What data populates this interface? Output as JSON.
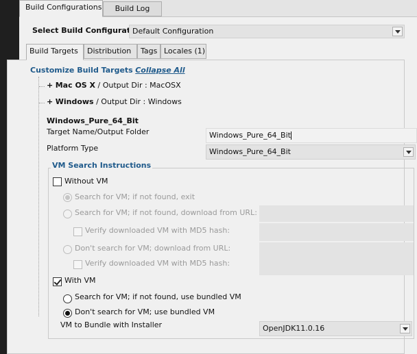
{
  "tabs": [
    "Build Configurations",
    "Build Log"
  ],
  "select_config": {
    "label": "Select Build Configuration",
    "value": "Default Configuration"
  },
  "inner_tabs": [
    "Build Targets",
    "Distribution",
    "Tags",
    "Locales (1)"
  ],
  "customize": {
    "title": "Customize Build Targets",
    "collapse_link": "Collapse All"
  },
  "targets": [
    {
      "expander": "+",
      "name": "Mac OS X",
      "suffix": " / Output Dir : MacOSX"
    },
    {
      "expander": "+",
      "name": "Windows",
      "suffix": " / Output Dir : Windows"
    }
  ],
  "detail": {
    "heading": "Windows_Pure_64_Bit",
    "target_name_label": "Target Name/Output Folder",
    "target_name_value": "Windows_Pure_64_Bit",
    "platform_label": "Platform Type",
    "platform_value": "Windows_Pure_64_Bit"
  },
  "vm": {
    "group_title": "VM Search Instructions",
    "without_vm": {
      "label": "Without VM",
      "checked": false
    },
    "without_options": [
      "Search for VM; if not found, exit",
      "Search for VM; if not found, download from URL:",
      "Verify downloaded VM with MD5 hash:",
      "Don't search for VM; download from URL:",
      "Verify downloaded VM with MD5 hash:"
    ],
    "with_vm": {
      "label": "With VM",
      "checked": true
    },
    "with_options": [
      "Search for VM; if not found, use bundled VM",
      "Don't search for VM; use bundled VM"
    ],
    "bundle_label": "VM to Bundle with Installer",
    "bundle_value": "OpenJDK11.0.16"
  }
}
